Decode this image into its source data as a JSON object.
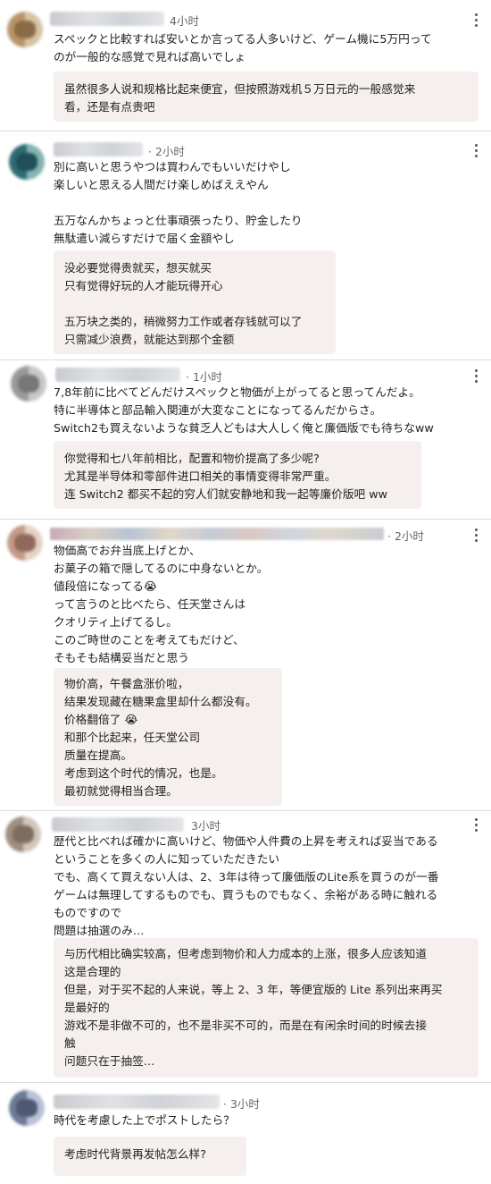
{
  "posts": [
    {
      "time": "4小时",
      "jp": [
        "スペックと比較すれば安いとか言ってる人多いけど、ゲーム機に5万円って",
        "のが一般的な感覚で見れば高いでしょ"
      ],
      "zh": [
        "虽然很多人说和规格比起来便宜，但按照游戏机５万日元的一般感觉来",
        "看，还是有点贵吧"
      ]
    },
    {
      "time": "· 2小时",
      "jp": [
        "別に高いと思うやつは買わんでもいいだけやし",
        "楽しいと思える人間だけ楽しめばええやん",
        "",
        "五万なんかちょっと仕事頑張ったり、貯金したり",
        "無駄遣い減らすだけで届く金額やし"
      ],
      "zh": [
        "没必要觉得贵就买，想买就买",
        "只有觉得好玩的人才能玩得开心",
        "",
        "五万块之类的，稍微努力工作或者存钱就可以了",
        "只需减少浪费，就能达到那个金额"
      ]
    },
    {
      "time": "· 1小时",
      "jp": [
        "7,8年前に比べてどんだけスペックと物価が上がってると思ってんだよ。",
        "特に半導体と部品輸入関連が大変なことになってるんだからさ。",
        "Switch2も買えないような貧乏人どもは大人しく俺と廉価版でも待ちなww"
      ],
      "zh": [
        "你觉得和七八年前相比，配置和物价提高了多少呢?",
        "尤其是半导体和零部件进口相关的事情变得非常严重。",
        "连 Switch2 都买不起的穷人们就安静地和我一起等廉价版吧 ww"
      ]
    },
    {
      "time": "· 2小时",
      "jp": [
        "物価高でお弁当底上げとか、",
        "お菓子の箱で隠してるのに中身ないとか。",
        "値段倍になってる😭",
        "って言うのと比べたら、任天堂さんは",
        "クオリティ上げてるし。",
        "このご時世のことを考えてもだけど、",
        "そもそも結構妥当だと思う"
      ],
      "zh": [
        "物价高，午餐盒涨价啦，",
        "结果发现藏在糖果盒里却什么都没有。",
        "价格翻倍了 😭",
        "和那个比起来，任天堂公司",
        "质量在提高。",
        "考虑到这个时代的情况，也是。",
        "最初就觉得相当合理。"
      ]
    },
    {
      "time": "3小时",
      "jp": [
        "歴代と比べれば確かに高いけど、物価や人件費の上昇を考えれば妥当である",
        "ということを多くの人に知っていただきたい",
        "でも、高くて買えない人は、2、3年は待って廉価版のLite系を買うのが一番",
        "ゲームは無理してするものでも、買うものでもなく、余裕がある時に触れる",
        "ものですので",
        "問題は抽選のみ…"
      ],
      "zh": [
        "与历代相比确实较高，但考虑到物价和人力成本的上涨，很多人应该知道",
        "这是合理的",
        "但是，对于买不起的人来说，等上 2、3 年，等便宜版的 Lite 系列出来再买",
        "是最好的",
        "游戏不是非做不可的，也不是非买不可的，而是在有闲余时间的时候去接",
        "触",
        "问题只在于抽签…"
      ]
    },
    {
      "time": "· 3小时",
      "jp": [
        "時代を考慮した上でポストしたら？"
      ],
      "zh": [
        "考虑时代背景再发帖怎么样?"
      ]
    }
  ],
  "colors": {
    "avatars": [
      [
        "#b8956a",
        "#d7c3a3",
        "#8a6b45"
      ],
      [
        "#2f6b73",
        "#86b3b3",
        "#1f4f57"
      ],
      [
        "#9a9a9a",
        "#c8c8c8",
        "#777777"
      ],
      [
        "#c49a8a",
        "#e6d3c8",
        "#8f6a5c"
      ],
      [
        "#a08f80",
        "#d2c7bb",
        "#7d6d60"
      ],
      [
        "#6d7a96",
        "#b9c2d6",
        "#4d5873"
      ]
    ],
    "bubble": "#f5efee"
  }
}
